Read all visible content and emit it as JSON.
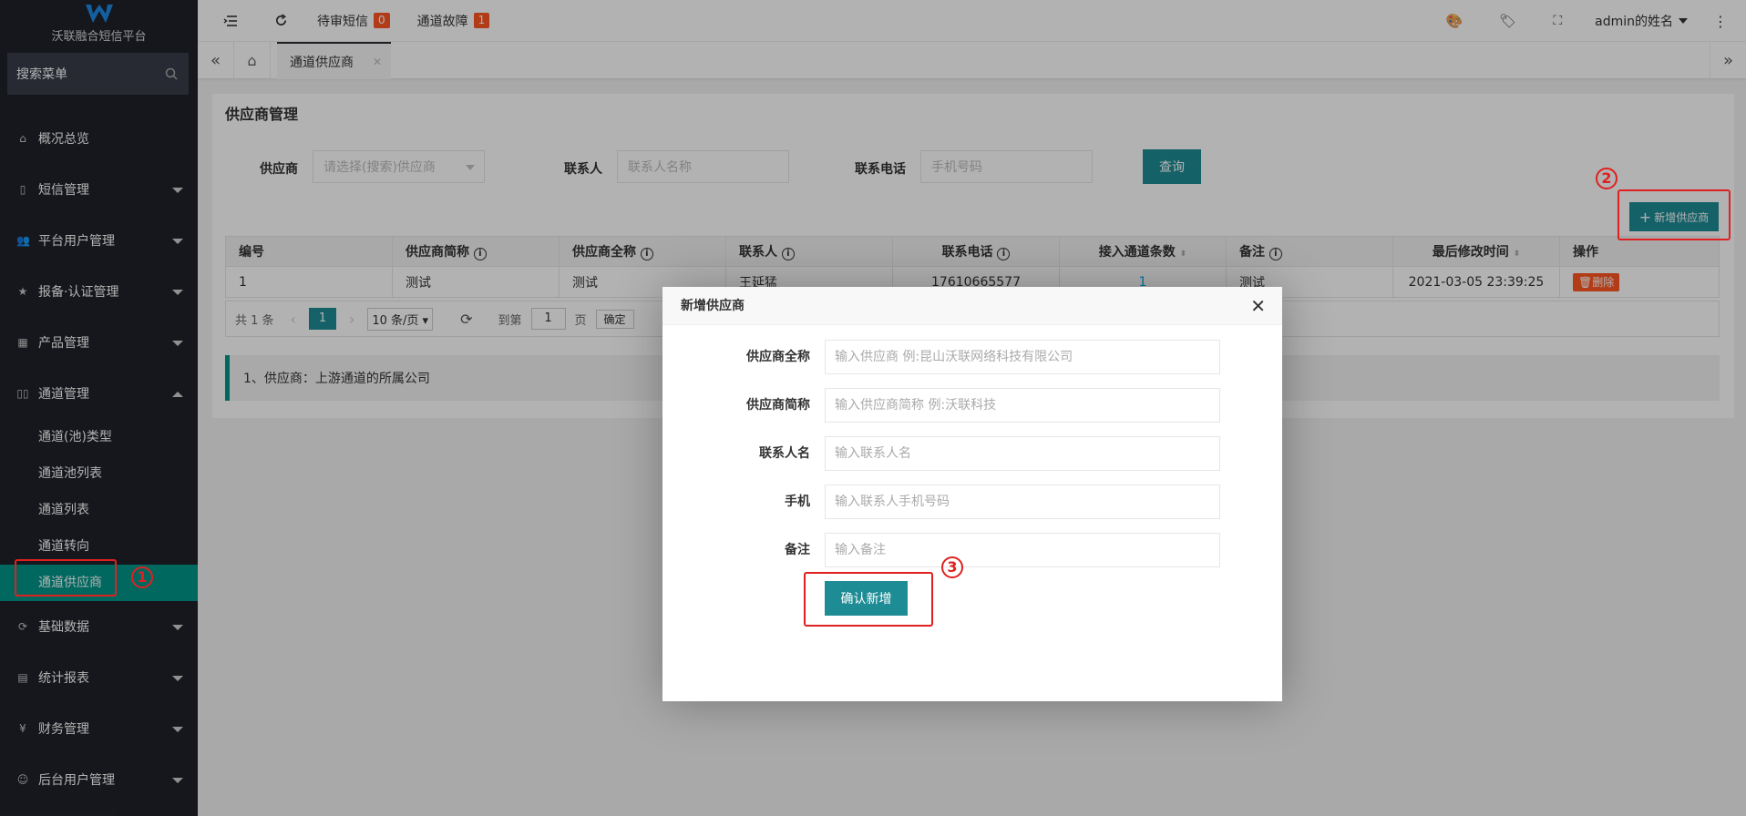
{
  "brand": {
    "name": "沃联融合短信平台"
  },
  "sidebar": {
    "search_label": "搜索菜单",
    "items": [
      {
        "label": "概况总览",
        "icon": "home-icon"
      },
      {
        "label": "短信管理",
        "icon": "mobile-icon"
      },
      {
        "label": "平台用户管理",
        "icon": "users-icon"
      },
      {
        "label": "报备·认证管理",
        "icon": "star-icon"
      },
      {
        "label": "产品管理",
        "icon": "app-icon"
      },
      {
        "label": "通道管理",
        "icon": "channel-icon"
      }
    ],
    "sub_items": [
      "通道(池)类型",
      "通道池列表",
      "通道列表",
      "通道转向",
      "通道供应商"
    ],
    "items_after": [
      {
        "label": "基础数据",
        "icon": "refresh-icon"
      },
      {
        "label": "统计报表",
        "icon": "table-icon"
      },
      {
        "label": "财务管理",
        "icon": "yen-icon"
      },
      {
        "label": "后台用户管理",
        "icon": "user-icon"
      }
    ]
  },
  "header": {
    "pending_sms": "待审短信",
    "pending_count": "0",
    "channel_fault": "通道故障",
    "fault_count": "1",
    "user": "admin的姓名"
  },
  "tabs": {
    "active": "通道供应商"
  },
  "page": {
    "title": "供应商管理",
    "filters": {
      "supplier_label": "供应商",
      "supplier_placeholder": "请选择(搜索)供应商",
      "contact_label": "联系人",
      "contact_placeholder": "联系人名称",
      "phone_label": "联系电话",
      "phone_placeholder": "手机号码",
      "query": "查询"
    },
    "add_button": "新增供应商",
    "table": {
      "headers": [
        "编号",
        "供应商简称",
        "供应商全称",
        "联系人",
        "联系电话",
        "接入通道条数",
        "备注",
        "最后修改时间",
        "操作"
      ],
      "row": {
        "id": "1",
        "short": "测试",
        "full": "测试",
        "contact": "王延猛",
        "phone": "17610665577",
        "channels": "1",
        "note": "测试",
        "time": "2021-03-05 23:39:25",
        "delete": "删除"
      }
    },
    "pager": {
      "total": "共 1 条",
      "page": "1",
      "size": "10 条/页",
      "goto": "到第",
      "goto_val": "1",
      "page_unit": "页",
      "confirm": "确定"
    },
    "tip": "1、供应商：上游通道的所属公司"
  },
  "modal": {
    "title": "新增供应商",
    "fields": [
      {
        "label": "供应商全称",
        "placeholder": "输入供应商 例:昆山沃联网络科技有限公司"
      },
      {
        "label": "供应商简称",
        "placeholder": "输入供应商简称 例:沃联科技"
      },
      {
        "label": "联系人名",
        "placeholder": "输入联系人名"
      },
      {
        "label": "手机",
        "placeholder": "输入联系人手机号码"
      },
      {
        "label": "备注",
        "placeholder": "输入备注"
      }
    ],
    "submit": "确认新增"
  },
  "annotations": [
    "1",
    "2",
    "3"
  ],
  "colors": {
    "accent": "#009688",
    "button": "#1e8c95",
    "sidebar": "#20222a",
    "danger": "#ff5722",
    "annotation": "#e02020"
  }
}
